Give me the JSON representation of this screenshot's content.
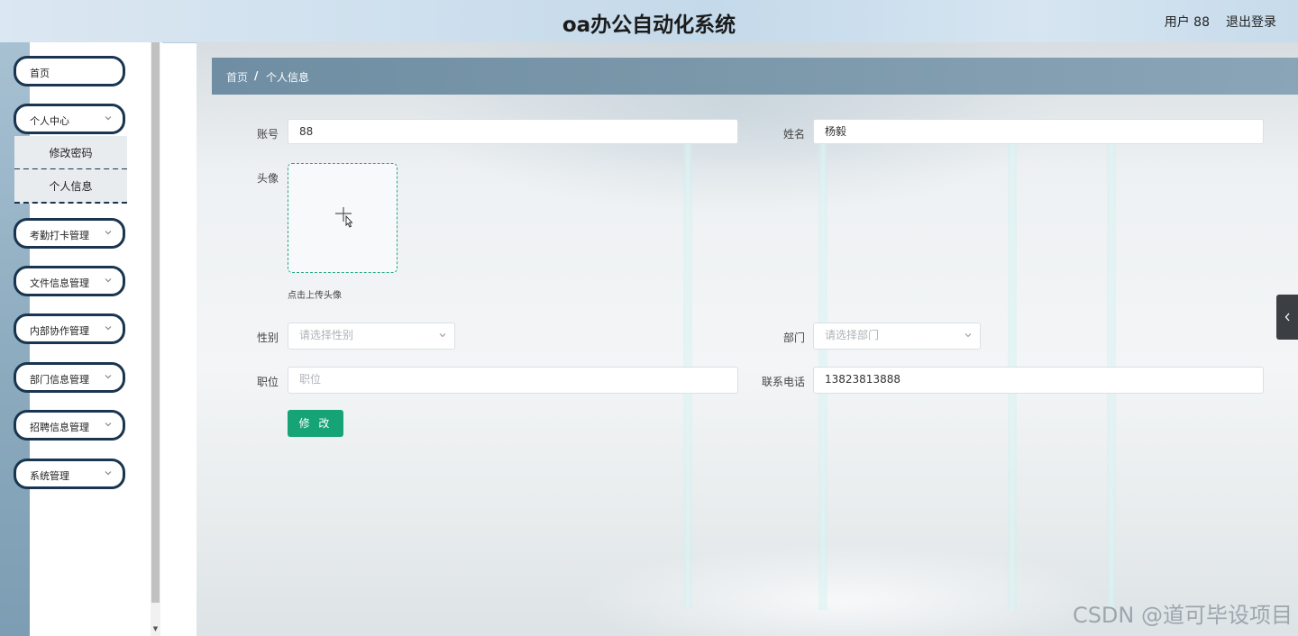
{
  "header": {
    "title": "oa办公自动化系统",
    "user": "用户 88",
    "logout": "退出登录"
  },
  "sidebar": {
    "items": [
      {
        "label": "首页"
      },
      {
        "label": "个人中心",
        "expanded": true,
        "children": [
          "修改密码",
          "个人信息"
        ]
      },
      {
        "label": "考勤打卡管理"
      },
      {
        "label": "文件信息管理"
      },
      {
        "label": "内部协作管理"
      },
      {
        "label": "部门信息管理"
      },
      {
        "label": "招聘信息管理"
      },
      {
        "label": "系统管理"
      }
    ]
  },
  "breadcrumb": {
    "home": "首页",
    "separator": "/",
    "current": "个人信息"
  },
  "form": {
    "account_label": "账号",
    "account_value": "88",
    "name_label": "姓名",
    "name_value": "杨毅",
    "avatar_label": "头像",
    "avatar_hint": "点击上传头像",
    "gender_label": "性别",
    "gender_placeholder": "请选择性别",
    "department_label": "部门",
    "department_placeholder": "请选择部门",
    "position_label": "职位",
    "position_placeholder": "职位",
    "phone_label": "联系电话",
    "phone_value": "13823813888",
    "submit_label": "修 改"
  },
  "watermark": "CSDN @道可毕设项目",
  "colors": {
    "menu_border": "#1a3550",
    "submit_green": "#16a476",
    "breadcrumb_bg": "#7c98ab"
  }
}
